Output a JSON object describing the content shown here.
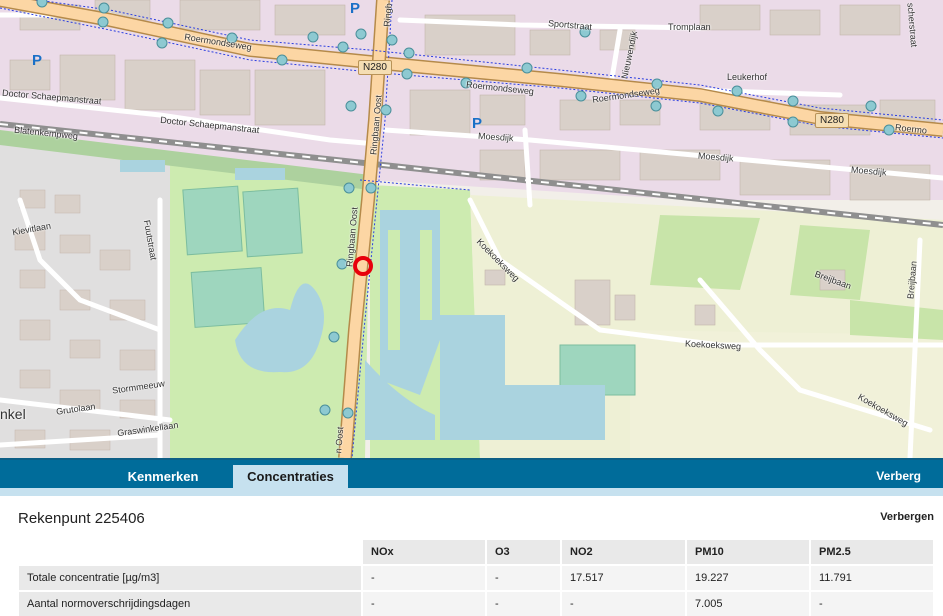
{
  "map": {
    "labels": {
      "roermondseweg_w": "Roermondseweg",
      "roermondseweg_mid": "Roermondseweg",
      "roermondseweg_e": "Roermondseweg",
      "roermondseweg_far": "Roermo",
      "doctor_1": "Doctor Schaepmanstraat",
      "doctor_2": "Doctor Schaepmanstraat",
      "blatenkempweg": "Blatenkempweg",
      "moesdijk_1": "Moesdijk",
      "moesdijk_2": "Moesdijk",
      "moesdijk_3": "Moesdijk",
      "sportstraat": "Sportstraat",
      "tromplaan": "Tromplaan",
      "nieuwendijk": "Nieuwendijk",
      "leukerhof": "Leukerhof",
      "ringbaan_1": "Ringbaan Oost",
      "ringbaan_2": "Ringbaan Oost",
      "ringbaan_3": "Ringb",
      "ringbaan_4": "n Oost",
      "koekoeksweg_1": "Koekoeksweg",
      "koekoeksweg_2": "Koekoeksweg",
      "koekoeksweg_3": "Koekoeksweg",
      "breijbaan_1": "Breijbaan",
      "breijbaan_2": "Breijbaan",
      "fuutstraat": "Fuutstraat",
      "kievitlaan": "Kievitlaan",
      "stormmeeuw": "Stormmeeuw",
      "grutolaan": "Grutolaan",
      "graswinkellaan": "Graswinkellaan",
      "inkel": "nkel",
      "scherstraat": "scherstraat"
    },
    "shields": {
      "n280_a": "N280",
      "n280_b": "N280"
    },
    "parking_symbol": "P",
    "marker_icon": "calculation-point-marker-icon"
  },
  "tabs": {
    "kenmerken": "Kenmerken",
    "concentraties": "Concentraties",
    "hide": "Verberg"
  },
  "panel": {
    "title": "Rekenpunt 225406",
    "close": "Verbergen",
    "table": {
      "headers": [
        "",
        "NOx",
        "O3",
        "NO2",
        "PM10",
        "PM2.5"
      ],
      "rows": [
        [
          "Totale concentratie [µg/m3]",
          "-",
          "-",
          "17.517",
          "19.227",
          "11.791"
        ],
        [
          "Aantal normoverschrijdingsdagen",
          "-",
          "-",
          "-",
          "7.005",
          "-"
        ]
      ]
    }
  },
  "colors": {
    "accent": "#006c9a",
    "active_tab": "#c6e1ef",
    "marker": "#e8000b"
  }
}
